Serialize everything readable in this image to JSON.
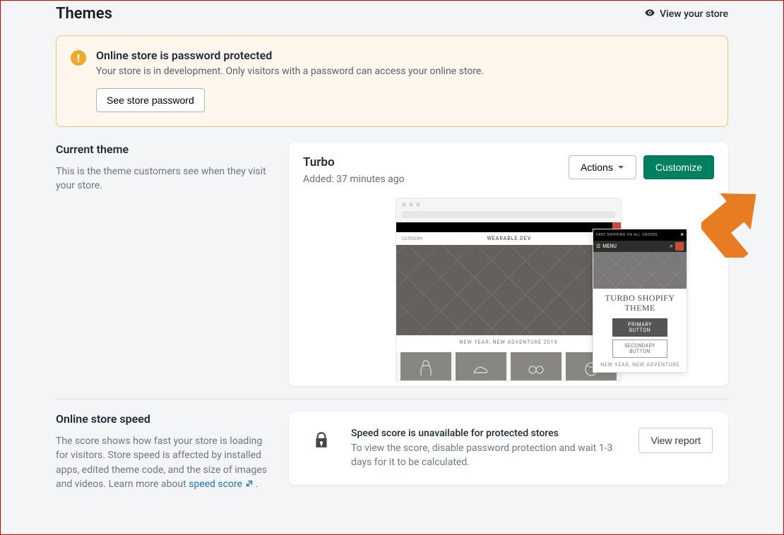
{
  "header": {
    "page_title": "Themes",
    "view_store": "View your store"
  },
  "banner": {
    "title": "Online store is password protected",
    "description": "Your store is in development. Only visitors with a password can access your online store.",
    "button_label": "See store password"
  },
  "current_theme": {
    "heading": "Current theme",
    "description": "This is the theme customers see when they visit your store.",
    "theme_name": "Turbo",
    "added_text": "Added: 37 minutes ago",
    "actions_label": "Actions",
    "customize_label": "Customize",
    "preview": {
      "desktop_brand": "WEARABLE.DEV",
      "desktop_tagline": "NEW YEAR, NEW ADVENTURE 2019",
      "mobile_menu": "MENU",
      "mobile_announcement": "FREE SHIPPING ON ALL ORDERS",
      "mobile_heading": "TURBO SHOPIFY THEME",
      "mobile_primary_btn": "PRIMARY BUTTON",
      "mobile_secondary_btn": "SECONDARY BUTTON",
      "mobile_tagline": "NEW YEAR, NEW ADVENTURE"
    }
  },
  "speed": {
    "heading": "Online store speed",
    "description_pre": "The score shows how fast your store is loading for visitors. Store speed is affected by installed apps, edited theme code, and the size of images and videos. Learn more about ",
    "link_label": "speed score",
    "description_post": " .",
    "card_title": "Speed score is unavailable for protected stores",
    "card_desc": "To view the score, disable password protection and wait 1-3 days for it to be calculated.",
    "report_button": "View report"
  }
}
